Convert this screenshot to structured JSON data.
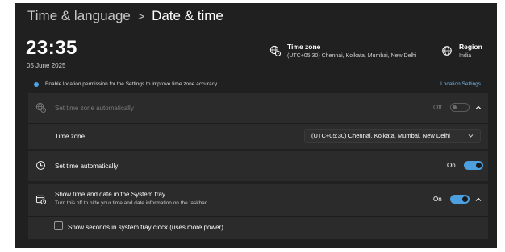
{
  "breadcrumb": {
    "parent": "Time & language",
    "separator": ">",
    "current": "Date & time"
  },
  "clock": {
    "time": "23:35",
    "date": "05 June 2025"
  },
  "timezone_info": {
    "title": "Time zone",
    "value": "(UTC+05:30) Chennai, Kolkata, Mumbai, New Delhi",
    "icon": "globe-clock-icon"
  },
  "region_info": {
    "title": "Region",
    "value": "India",
    "icon": "globe-icon"
  },
  "notice": {
    "text": "Enable location permission for the Settings to improve time zone accuracy.",
    "link": "Location Settings"
  },
  "settings": {
    "auto_timezone": {
      "label": "Set time zone automatically",
      "state": "Off",
      "icon": "globe-clock-icon"
    },
    "timezone_select": {
      "label": "Time zone",
      "value": "(UTC+05:30) Chennai, Kolkata, Mumbai, New Delhi"
    },
    "auto_time": {
      "label": "Set time automatically",
      "state": "On",
      "icon": "clock-icon"
    },
    "systray": {
      "label": "Show time and date in the System tray",
      "sublabel": "Turn this off to hide your time and date information on the taskbar",
      "state": "On",
      "icon": "calendar-clock-icon"
    },
    "seconds": {
      "label": "Show seconds in system tray clock (uses more power)",
      "checked": false
    }
  },
  "colors": {
    "accent": "#4ca0e0",
    "background": "#202020",
    "card": "#2b2b2b",
    "link": "#77b7ee"
  }
}
